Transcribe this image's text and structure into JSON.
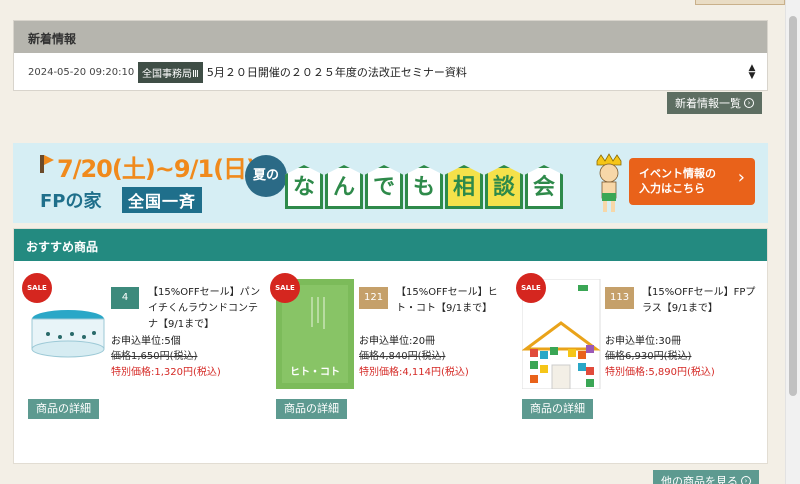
{
  "news": {
    "heading": "新着情報",
    "items": [
      {
        "date": "2024-05-20 09:20:10",
        "tag": "全国事務局Ⅲ",
        "title": "5月２０日開催の２０２５年度の法改正セミナー資料"
      }
    ],
    "list_button": "新着情報一覧"
  },
  "banner": {
    "date_range": "7/20(土)~9/1(日)",
    "brand": "FPの家",
    "nationwide": "全国一斉",
    "summer": "夏の",
    "main_chars": [
      "な",
      "ん",
      "で",
      "も",
      "相",
      "談",
      "会"
    ],
    "cta_line1": "イベント情報の",
    "cta_line2": "入力はこちら",
    "colors": {
      "orange": "#f08a1c",
      "navy": "#1f6f8b",
      "green": "#2e8a4a",
      "cta": "#e9621a"
    }
  },
  "recommended": {
    "heading": "おすすめ商品",
    "more_button": "他の商品を見る",
    "products": [
      {
        "sale_badge": "SALE",
        "number": "4",
        "number_color": "#3d8a7c",
        "name": "【15%OFFセール】パンイチくんラウンドコンテナ【9/1まで】",
        "unit": "お申込単位:5個",
        "original_price": "価格1,650円(税込)",
        "special_price": "特別価格:1,320円(税込)",
        "detail_button": "商品の詳細",
        "image": "container-icon"
      },
      {
        "sale_badge": "SALE",
        "number": "121",
        "number_color": "#c5a06a",
        "name": "【15%OFFセール】ヒト・コト【9/1まで】",
        "unit": "お申込単位:20冊",
        "original_price": "価格4,840円(税込)",
        "special_price": "特別価格:4,114円(税込)",
        "detail_button": "商品の詳細",
        "image": "book-hitokoto-icon",
        "cover_text": "ヒト・コト"
      },
      {
        "sale_badge": "SALE",
        "number": "113",
        "number_color": "#c5a06a",
        "name": "【15%OFFセール】FPプラス【9/1まで】",
        "unit": "お申込単位:30冊",
        "original_price": "価格6,930円(税込)",
        "special_price": "特別価格:5,890円(税込)",
        "detail_button": "商品の詳細",
        "image": "book-fpplus-icon"
      }
    ]
  }
}
